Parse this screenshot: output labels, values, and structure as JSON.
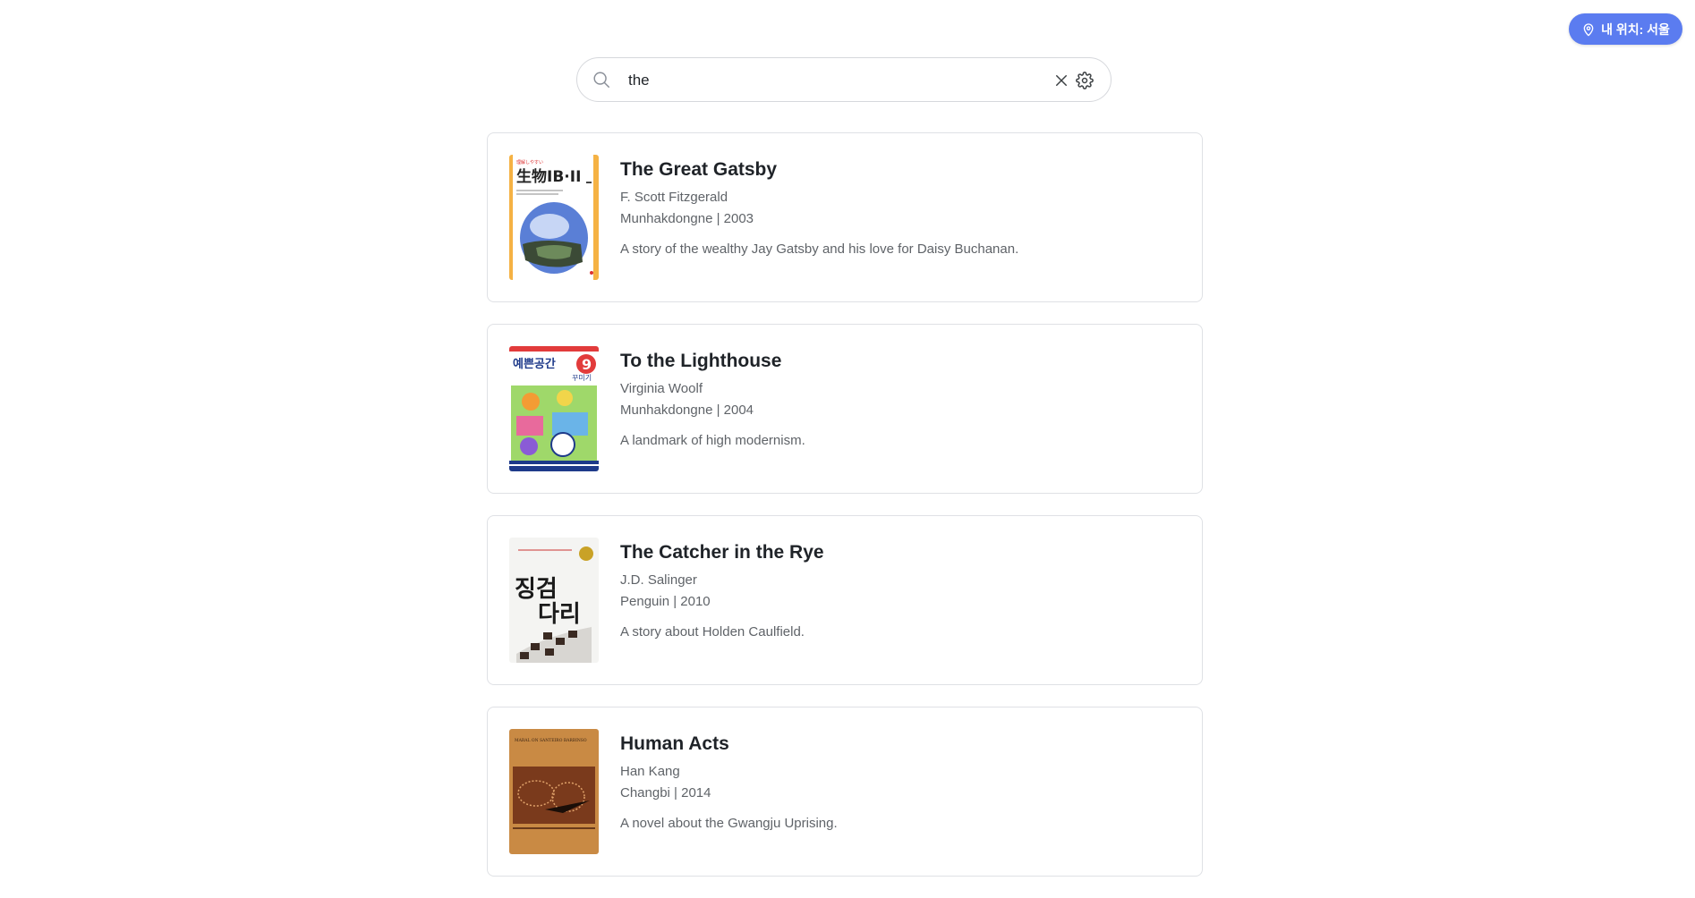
{
  "location": {
    "label": "내 위치: 서울",
    "icon": "map-pin-icon",
    "color": "#5b7cf0"
  },
  "search": {
    "value": "the",
    "placeholder": ""
  },
  "books": [
    {
      "title": "The Great Gatsby",
      "author": "F. Scott Fitzgerald",
      "publisher": "Munhakdongne | 2003",
      "description": "A story of the wealthy Jay Gatsby and his love for Daisy Buchanan.",
      "cover_top_text": "理解しやすい",
      "cover_title": "生物IB·II"
    },
    {
      "title": "To the Lighthouse",
      "author": "Virginia Woolf",
      "publisher": "Munhakdongne | 2004",
      "description": "A landmark of high modernism.",
      "cover_title": "예쁜공간",
      "cover_number": "9",
      "cover_sub": "꾸미기"
    },
    {
      "title": "The Catcher in the Rye",
      "author": "J.D. Salinger",
      "publisher": "Penguin | 2010",
      "description": "A story about Holden Caulfield.",
      "cover_title_line1": "징검",
      "cover_title_line2": "다리"
    },
    {
      "title": "Human Acts",
      "author": "Han Kang",
      "publisher": "Changbi | 2014",
      "description": "A novel about the Gwangju Uprising.",
      "cover_top_text": "MARAL ON SANTEIRO BARBINSO"
    }
  ]
}
